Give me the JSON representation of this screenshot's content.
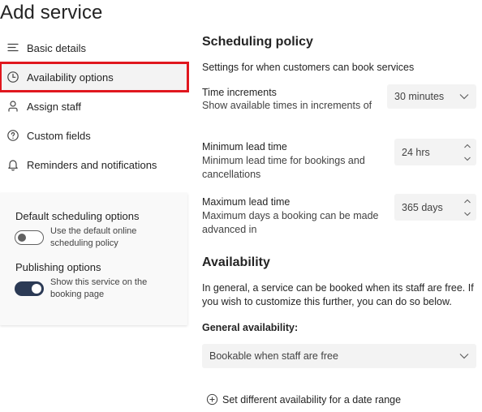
{
  "page": {
    "title": "Add service"
  },
  "nav": {
    "items": [
      {
        "label": "Basic details",
        "icon": "lines-icon"
      },
      {
        "label": "Availability options",
        "icon": "clock-icon",
        "selected": true
      },
      {
        "label": "Assign staff",
        "icon": "person-icon"
      },
      {
        "label": "Custom fields",
        "icon": "question-icon"
      },
      {
        "label": "Reminders and notifications",
        "icon": "bell-icon"
      }
    ]
  },
  "options_card": {
    "default_heading": "Default scheduling options",
    "default_toggle_label": "Use the default online scheduling policy",
    "default_toggle_on": false,
    "publishing_heading": "Publishing options",
    "publishing_toggle_label": "Show this service on the booking page",
    "publishing_toggle_on": true
  },
  "scheduling": {
    "title": "Scheduling policy",
    "intro": "Settings for when customers can book services",
    "time_increments": {
      "label": "Time increments",
      "description": "Show available times in increments of",
      "value": "30 minutes"
    },
    "min_lead": {
      "label": "Minimum lead time",
      "description": "Minimum lead time for bookings and cancellations",
      "value": "24 hrs"
    },
    "max_lead": {
      "label": "Maximum lead time",
      "description": "Maximum days a booking can be made advanced in",
      "value": "365 days"
    }
  },
  "availability": {
    "title": "Availability",
    "description": "In general, a service can be booked when its staff are free. If you wish to customize this further, you can do so below.",
    "general_label": "General availability:",
    "general_value": "Bookable when staff are free",
    "date_range_link": "Set different availability for a date range"
  },
  "colors": {
    "highlight_border": "#e0171e",
    "toggle_on": "#2b3a55",
    "card_bg": "#f9f9f9",
    "input_bg": "#f3f3f3"
  }
}
